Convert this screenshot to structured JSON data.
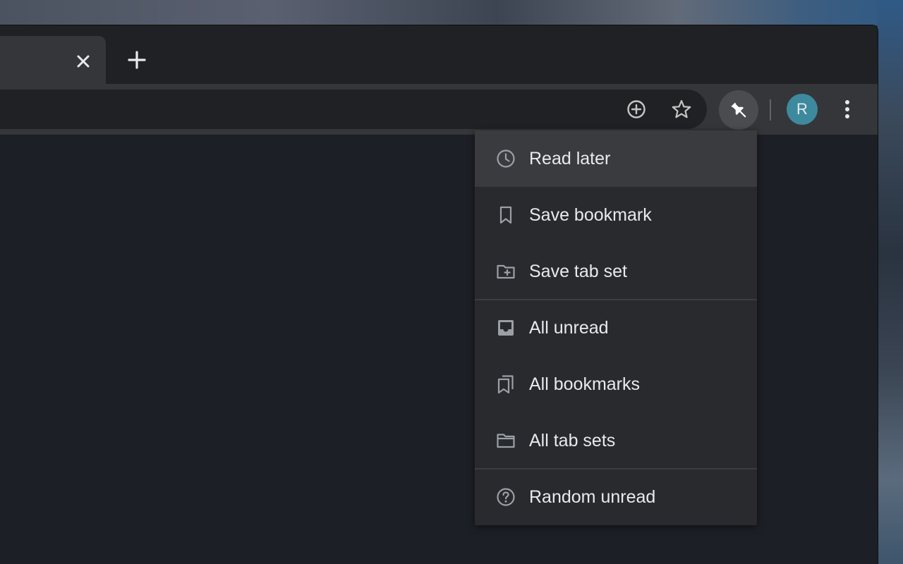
{
  "browser": {
    "tab": {
      "close_icon": "close-icon"
    },
    "new_tab_icon": "plus-icon",
    "toolbar": {
      "add_icon": "add-circle-icon",
      "star_icon": "star-icon",
      "extension_icon": "pin-icon",
      "profile_initial": "R",
      "more_icon": "more-vert-icon"
    }
  },
  "menu": {
    "items": [
      {
        "label": "Read later",
        "icon": "clock-icon",
        "highlighted": true
      },
      {
        "label": "Save bookmark",
        "icon": "bookmark-icon"
      },
      {
        "label": "Save tab set",
        "icon": "folder-add-icon"
      },
      {
        "label": "All unread",
        "icon": "inbox-icon"
      },
      {
        "label": "All bookmarks",
        "icon": "bookmarks-icon"
      },
      {
        "label": "All tab sets",
        "icon": "folder-icon"
      },
      {
        "label": "Random unread",
        "icon": "help-circle-icon"
      }
    ]
  },
  "colors": {
    "accent_avatar": "#3d8a9e",
    "menu_bg": "#292a2d",
    "menu_highlight": "#3a3b3f",
    "content_bg": "#1d1f27"
  }
}
